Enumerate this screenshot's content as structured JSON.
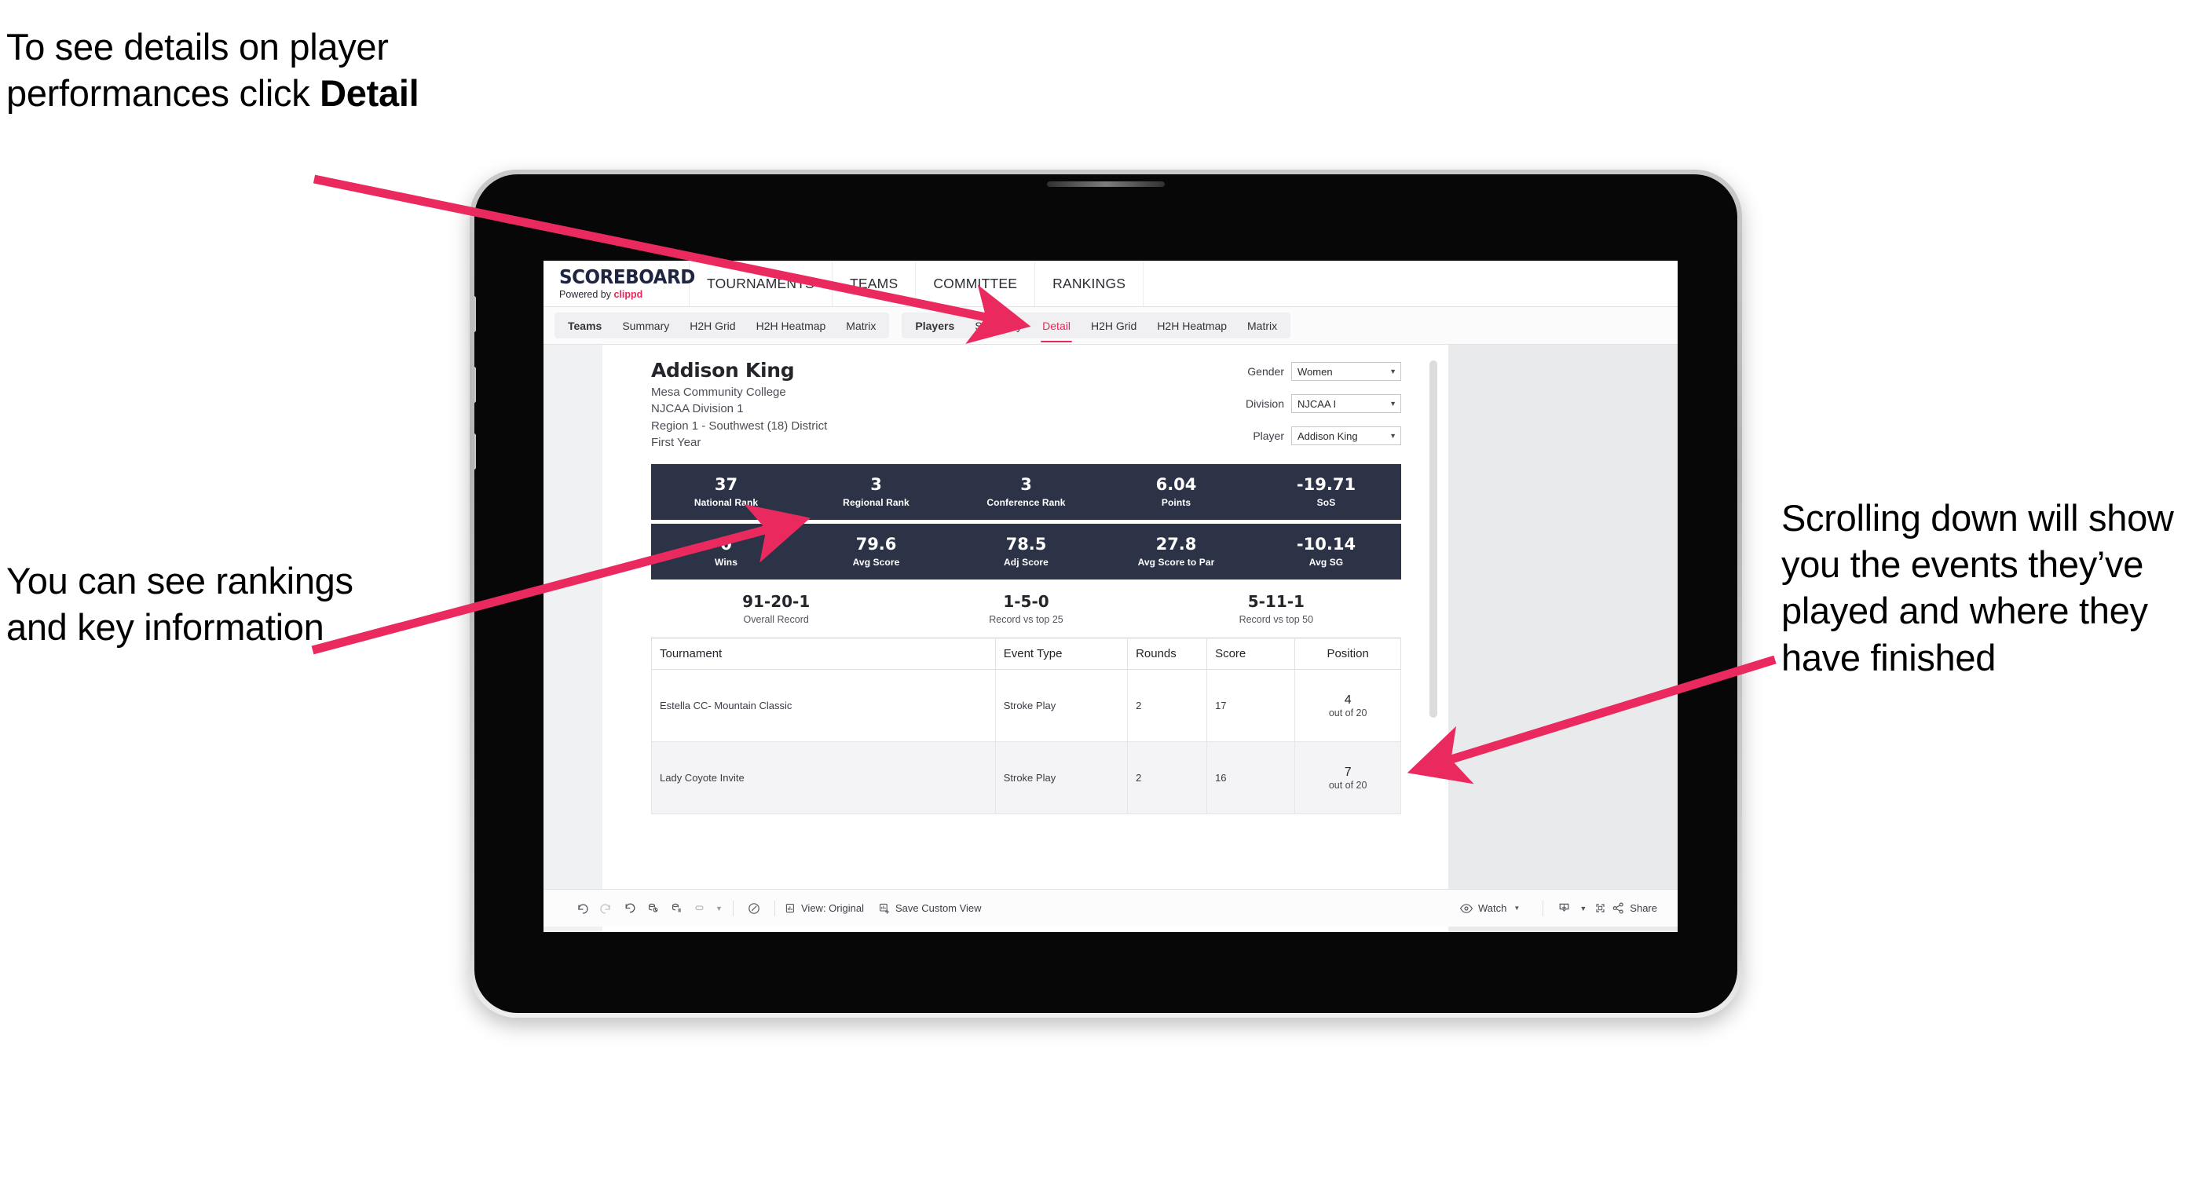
{
  "annotations": {
    "top_left": "To see details on player performances click ",
    "top_left_bold": "Detail",
    "mid_left": "You can see rankings and key information",
    "right": "Scrolling down will show you the events they’ve played and where they have finished",
    "arrow_color": "#ea2a5f"
  },
  "app": {
    "logo": {
      "title": "SCOREBOARD",
      "powered_prefix": "Powered by ",
      "brand": "clippd"
    },
    "top_nav": [
      "TOURNAMENTS",
      "TEAMS",
      "COMMITTEE",
      "RANKINGS"
    ],
    "tabs_teams": {
      "lead": "Teams",
      "items": [
        "Summary",
        "H2H Grid",
        "H2H Heatmap",
        "Matrix"
      ]
    },
    "tabs_players": {
      "lead": "Players",
      "items": [
        "Summary",
        "Detail",
        "H2H Grid",
        "H2H Heatmap",
        "Matrix"
      ],
      "active": "Detail"
    },
    "accent_color": "#e8285a"
  },
  "player": {
    "name": "Addison King",
    "school": "Mesa Community College",
    "division": "NJCAA Division 1",
    "region": "Region 1 - Southwest (18) District",
    "year": "First Year"
  },
  "filters": [
    {
      "label": "Gender",
      "value": "Women"
    },
    {
      "label": "Division",
      "value": "NJCAA I"
    },
    {
      "label": "Player",
      "value": "Addison King"
    }
  ],
  "stats_row1": [
    {
      "value": "37",
      "label": "National Rank"
    },
    {
      "value": "3",
      "label": "Regional Rank"
    },
    {
      "value": "3",
      "label": "Conference Rank"
    },
    {
      "value": "6.04",
      "label": "Points"
    },
    {
      "value": "-19.71",
      "label": "SoS"
    }
  ],
  "stats_row2": [
    {
      "value": "0",
      "label": "Wins"
    },
    {
      "value": "79.6",
      "label": "Avg Score"
    },
    {
      "value": "78.5",
      "label": "Adj Score"
    },
    {
      "value": "27.8",
      "label": "Avg Score to Par"
    },
    {
      "value": "-10.14",
      "label": "Avg SG"
    }
  ],
  "records": [
    {
      "value": "91-20-1",
      "label": "Overall Record"
    },
    {
      "value": "1-5-0",
      "label": "Record vs top 25"
    },
    {
      "value": "5-11-1",
      "label": "Record vs top 50"
    }
  ],
  "events_table": {
    "headers": [
      "Tournament",
      "Event Type",
      "Rounds",
      "Score",
      "Position"
    ],
    "rows": [
      {
        "tournament": "Estella CC- Mountain Classic",
        "event_type": "Stroke Play",
        "rounds": "2",
        "score": "17",
        "position": "4",
        "position_of": "out of 20"
      },
      {
        "tournament": "Lady Coyote Invite",
        "event_type": "Stroke Play",
        "rounds": "2",
        "score": "16",
        "position": "7",
        "position_of": "out of 20"
      }
    ]
  },
  "toolbar": {
    "view_original": "View: Original",
    "save_custom_view": "Save Custom View",
    "watch": "Watch",
    "share": "Share"
  }
}
